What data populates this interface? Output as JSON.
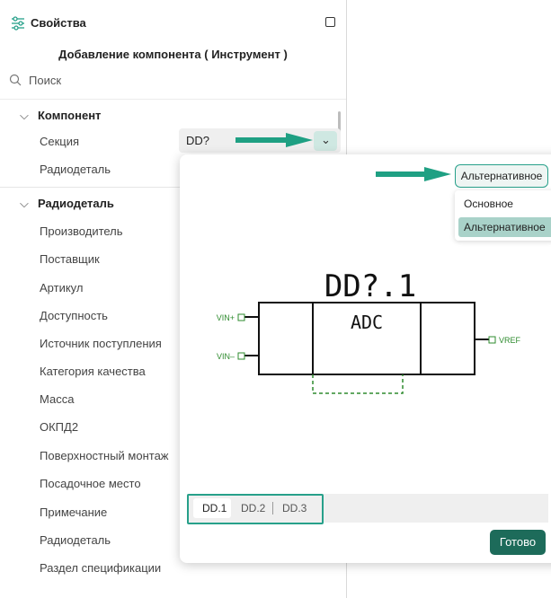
{
  "panel": {
    "title": "Свойства",
    "subtitle": "Добавление компонента ( Инструмент )",
    "search_placeholder": "Поиск"
  },
  "groups": [
    {
      "label": "Компонент",
      "props": [
        "Секция",
        "Радиодеталь"
      ]
    },
    {
      "label": "Радиодеталь",
      "props": [
        "Производитель",
        "Поставщик",
        "Артикул",
        "Доступность",
        "Источник поступления",
        "Категория качества",
        "Масса",
        "ОКПД2",
        "Поверхностный монтаж",
        "Посадочное место",
        "Примечание",
        "Радиодеталь",
        "Раздел спецификации"
      ]
    }
  ],
  "section_field": {
    "value": "DD?",
    "button": "⌄"
  },
  "popup": {
    "mode_value": "Альтернативное",
    "mode_options": [
      "Основное",
      "Альтернативное"
    ],
    "symbol": {
      "ref": "DD?.1",
      "label": "ADC",
      "pins_left": [
        "VIN+",
        "VIN–"
      ],
      "pins_right": [
        "VREF"
      ]
    },
    "tabs": [
      "DD.1",
      "DD.2",
      "DD.3"
    ],
    "done": "Готово"
  },
  "colors": {
    "accent": "#27a08a",
    "done": "#1d6b5a",
    "pin_text": "#2e8b2e"
  }
}
